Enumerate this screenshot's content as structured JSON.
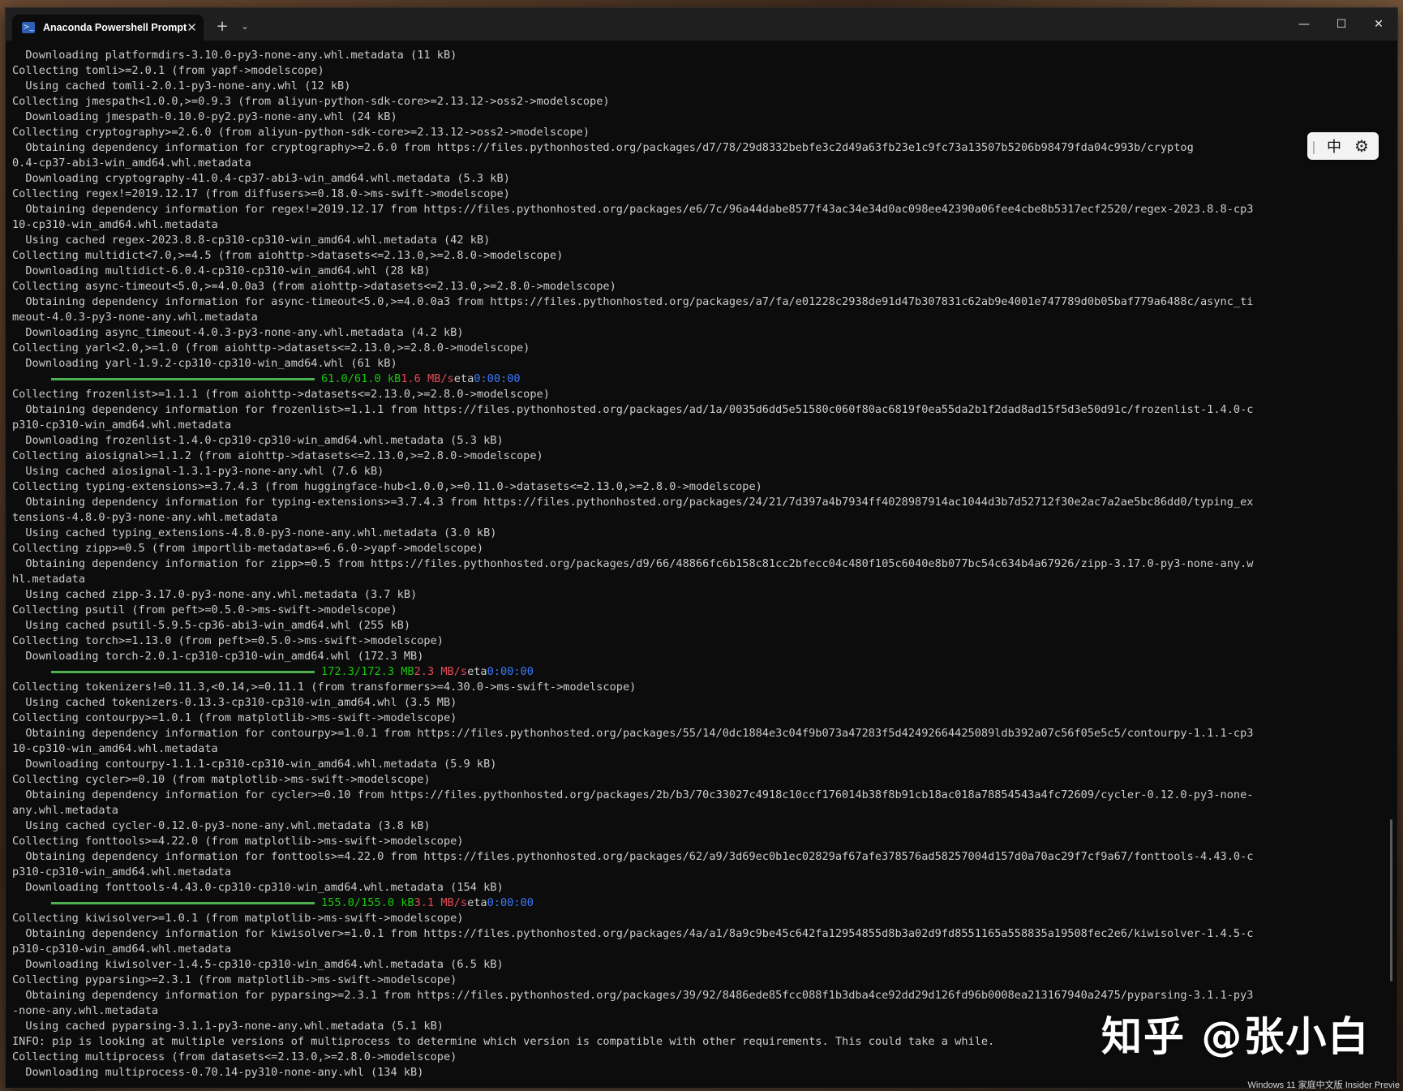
{
  "window": {
    "tab_title": "Anaconda Powershell Prompt",
    "tab_icon": "powershell-icon",
    "close_tab_label": "✕",
    "new_tab_label": "+",
    "dropdown_label": "⌄",
    "minimize_label": "—",
    "maximize_label": "☐",
    "close_label": "✕"
  },
  "terminal": {
    "lines": [
      "  Downloading platformdirs-3.10.0-py3-none-any.whl.metadata (11 kB)",
      "Collecting tomli>=2.0.1 (from yapf->modelscope)",
      "  Using cached tomli-2.0.1-py3-none-any.whl (12 kB)",
      "Collecting jmespath<1.0.0,>=0.9.3 (from aliyun-python-sdk-core>=2.13.12->oss2->modelscope)",
      "  Downloading jmespath-0.10.0-py2.py3-none-any.whl (24 kB)",
      "Collecting cryptography>=2.6.0 (from aliyun-python-sdk-core>=2.13.12->oss2->modelscope)",
      "  Obtaining dependency information for cryptography>=2.6.0 from https://files.pythonhosted.org/packages/d7/78/29d8332bebfe3c2d49a63fb23e1c9fc73a13507b5206b98479fda04c993b/cryptog",
      "0.4-cp37-abi3-win_amd64.whl.metadata",
      "  Downloading cryptography-41.0.4-cp37-abi3-win_amd64.whl.metadata (5.3 kB)",
      "Collecting regex!=2019.12.17 (from diffusers>=0.18.0->ms-swift->modelscope)",
      "  Obtaining dependency information for regex!=2019.12.17 from https://files.pythonhosted.org/packages/e6/7c/96a44dabe8577f43ac34e34d0ac098ee42390a06fee4cbe8b5317ecf2520/regex-2023.8.8-cp3",
      "10-cp310-win_amd64.whl.metadata",
      "  Using cached regex-2023.8.8-cp310-cp310-win_amd64.whl.metadata (42 kB)",
      "Collecting multidict<7.0,>=4.5 (from aiohttp->datasets<=2.13.0,>=2.8.0->modelscope)",
      "  Downloading multidict-6.0.4-cp310-cp310-win_amd64.whl (28 kB)",
      "Collecting async-timeout<5.0,>=4.0.0a3 (from aiohttp->datasets<=2.13.0,>=2.8.0->modelscope)",
      "  Obtaining dependency information for async-timeout<5.0,>=4.0.0a3 from https://files.pythonhosted.org/packages/a7/fa/e01228c2938de91d47b307831c62ab9e4001e747789d0b05baf779a6488c/async_ti",
      "meout-4.0.3-py3-none-any.whl.metadata",
      "  Downloading async_timeout-4.0.3-py3-none-any.whl.metadata (4.2 kB)",
      "Collecting yarl<2.0,>=1.0 (from aiohttp->datasets<=2.13.0,>=2.8.0->modelscope)",
      "  Downloading yarl-1.9.2-cp310-cp310-win_amd64.whl (61 kB)",
      "",
      "Collecting frozenlist>=1.1.1 (from aiohttp->datasets<=2.13.0,>=2.8.0->modelscope)",
      "  Obtaining dependency information for frozenlist>=1.1.1 from https://files.pythonhosted.org/packages/ad/1a/0035d6dd5e51580c060f80ac6819f0ea55da2b1f2dad8ad15f5d3e50d91c/frozenlist-1.4.0-c",
      "p310-cp310-win_amd64.whl.metadata",
      "  Downloading frozenlist-1.4.0-cp310-cp310-win_amd64.whl.metadata (5.3 kB)",
      "Collecting aiosignal>=1.1.2 (from aiohttp->datasets<=2.13.0,>=2.8.0->modelscope)",
      "  Using cached aiosignal-1.3.1-py3-none-any.whl (7.6 kB)",
      "Collecting typing-extensions>=3.7.4.3 (from huggingface-hub<1.0.0,>=0.11.0->datasets<=2.13.0,>=2.8.0->modelscope)",
      "  Obtaining dependency information for typing-extensions>=3.7.4.3 from https://files.pythonhosted.org/packages/24/21/7d397a4b7934ff4028987914ac1044d3b7d52712f30e2ac7a2ae5bc86dd0/typing_ex",
      "tensions-4.8.0-py3-none-any.whl.metadata",
      "  Using cached typing_extensions-4.8.0-py3-none-any.whl.metadata (3.0 kB)",
      "Collecting zipp>=0.5 (from importlib-metadata>=6.6.0->yapf->modelscope)",
      "  Obtaining dependency information for zipp>=0.5 from https://files.pythonhosted.org/packages/d9/66/48866fc6b158c81cc2bfecc04c480f105c6040e8b077bc54c634b4a67926/zipp-3.17.0-py3-none-any.w",
      "hl.metadata",
      "  Using cached zipp-3.17.0-py3-none-any.whl.metadata (3.7 kB)",
      "Collecting psutil (from peft>=0.5.0->ms-swift->modelscope)",
      "  Using cached psutil-5.9.5-cp36-abi3-win_amd64.whl (255 kB)",
      "Collecting torch>=1.13.0 (from peft>=0.5.0->ms-swift->modelscope)",
      "  Downloading torch-2.0.1-cp310-cp310-win_amd64.whl (172.3 MB)",
      "",
      "Collecting tokenizers!=0.11.3,<0.14,>=0.11.1 (from transformers>=4.30.0->ms-swift->modelscope)",
      "  Using cached tokenizers-0.13.3-cp310-cp310-win_amd64.whl (3.5 MB)",
      "Collecting contourpy>=1.0.1 (from matplotlib->ms-swift->modelscope)",
      "  Obtaining dependency information for contourpy>=1.0.1 from https://files.pythonhosted.org/packages/55/14/0dc1884e3c04f9b073a47283f5d42492664425089ldb392a07c56f05e5c5/contourpy-1.1.1-cp3",
      "10-cp310-win_amd64.whl.metadata",
      "  Downloading contourpy-1.1.1-cp310-cp310-win_amd64.whl.metadata (5.9 kB)",
      "Collecting cycler>=0.10 (from matplotlib->ms-swift->modelscope)",
      "  Obtaining dependency information for cycler>=0.10 from https://files.pythonhosted.org/packages/2b/b3/70c33027c4918c10ccf176014b38f8b91cb18ac018a78854543a4fc72609/cycler-0.12.0-py3-none-",
      "any.whl.metadata",
      "  Using cached cycler-0.12.0-py3-none-any.whl.metadata (3.8 kB)",
      "Collecting fonttools>=4.22.0 (from matplotlib->ms-swift->modelscope)",
      "  Obtaining dependency information for fonttools>=4.22.0 from https://files.pythonhosted.org/packages/62/a9/3d69ec0b1ec02829af67afe378576ad58257004d157d0a70ac29f7cf9a67/fonttools-4.43.0-c",
      "p310-cp310-win_amd64.whl.metadata",
      "  Downloading fonttools-4.43.0-cp310-cp310-win_amd64.whl.metadata (154 kB)",
      "",
      "Collecting kiwisolver>=1.0.1 (from matplotlib->ms-swift->modelscope)",
      "  Obtaining dependency information for kiwisolver>=1.0.1 from https://files.pythonhosted.org/packages/4a/a1/8a9c9be45c642fa12954855d8b3a02d9fd8551165a558835a19508fec2e6/kiwisolver-1.4.5-c",
      "p310-cp310-win_amd64.whl.metadata",
      "  Downloading kiwisolver-1.4.5-cp310-cp310-win_amd64.whl.metadata (6.5 kB)",
      "Collecting pyparsing>=2.3.1 (from matplotlib->ms-swift->modelscope)",
      "  Obtaining dependency information for pyparsing>=2.3.1 from https://files.pythonhosted.org/packages/39/92/8486ede85fcc088f1b3dba4ce92dd29d126fd96b0008ea213167940a2475/pyparsing-3.1.1-py3",
      "-none-any.whl.metadata",
      "  Using cached pyparsing-3.1.1-py3-none-any.whl.metadata (5.1 kB)",
      "INFO: pip is looking at multiple versions of multiprocess to determine which version is compatible with other requirements. This could take a while.",
      "Collecting multiprocess (from datasets<=2.13.0,>=2.8.0->modelscope)",
      "  Downloading multiprocess-0.70.14-py310-none-any.whl (134 kB)"
    ],
    "progress": [
      {
        "after_line": 20,
        "fraction": 1.0,
        "size": "61.0/61.0 kB",
        "speed": "1.6 MB/s",
        "eta_label": "eta",
        "eta": "0:00:00"
      },
      {
        "after_line": 39,
        "fraction": 1.0,
        "size": "172.3/172.3 MB",
        "speed": "2.3 MB/s",
        "eta_label": "eta",
        "eta": "0:00:00"
      },
      {
        "after_line": 54,
        "fraction": 1.0,
        "size": "155.0/155.0 kB",
        "speed": "3.1 MB/s",
        "eta_label": "eta",
        "eta": "0:00:00"
      }
    ]
  },
  "ime": {
    "handle": "|",
    "language": "中",
    "settings_icon": "gear-icon"
  },
  "overlay": {
    "watermark": "知乎 @张小白",
    "desktop_text": "Windows 11 家庭中文版 Insider Previe"
  },
  "colors": {
    "terminal_bg": "#0c0c0c",
    "text": "#cccccc",
    "progress_bar": "#4caf50",
    "size": "#16c60c",
    "speed": "#e74856",
    "eta": "#3b78ff"
  }
}
